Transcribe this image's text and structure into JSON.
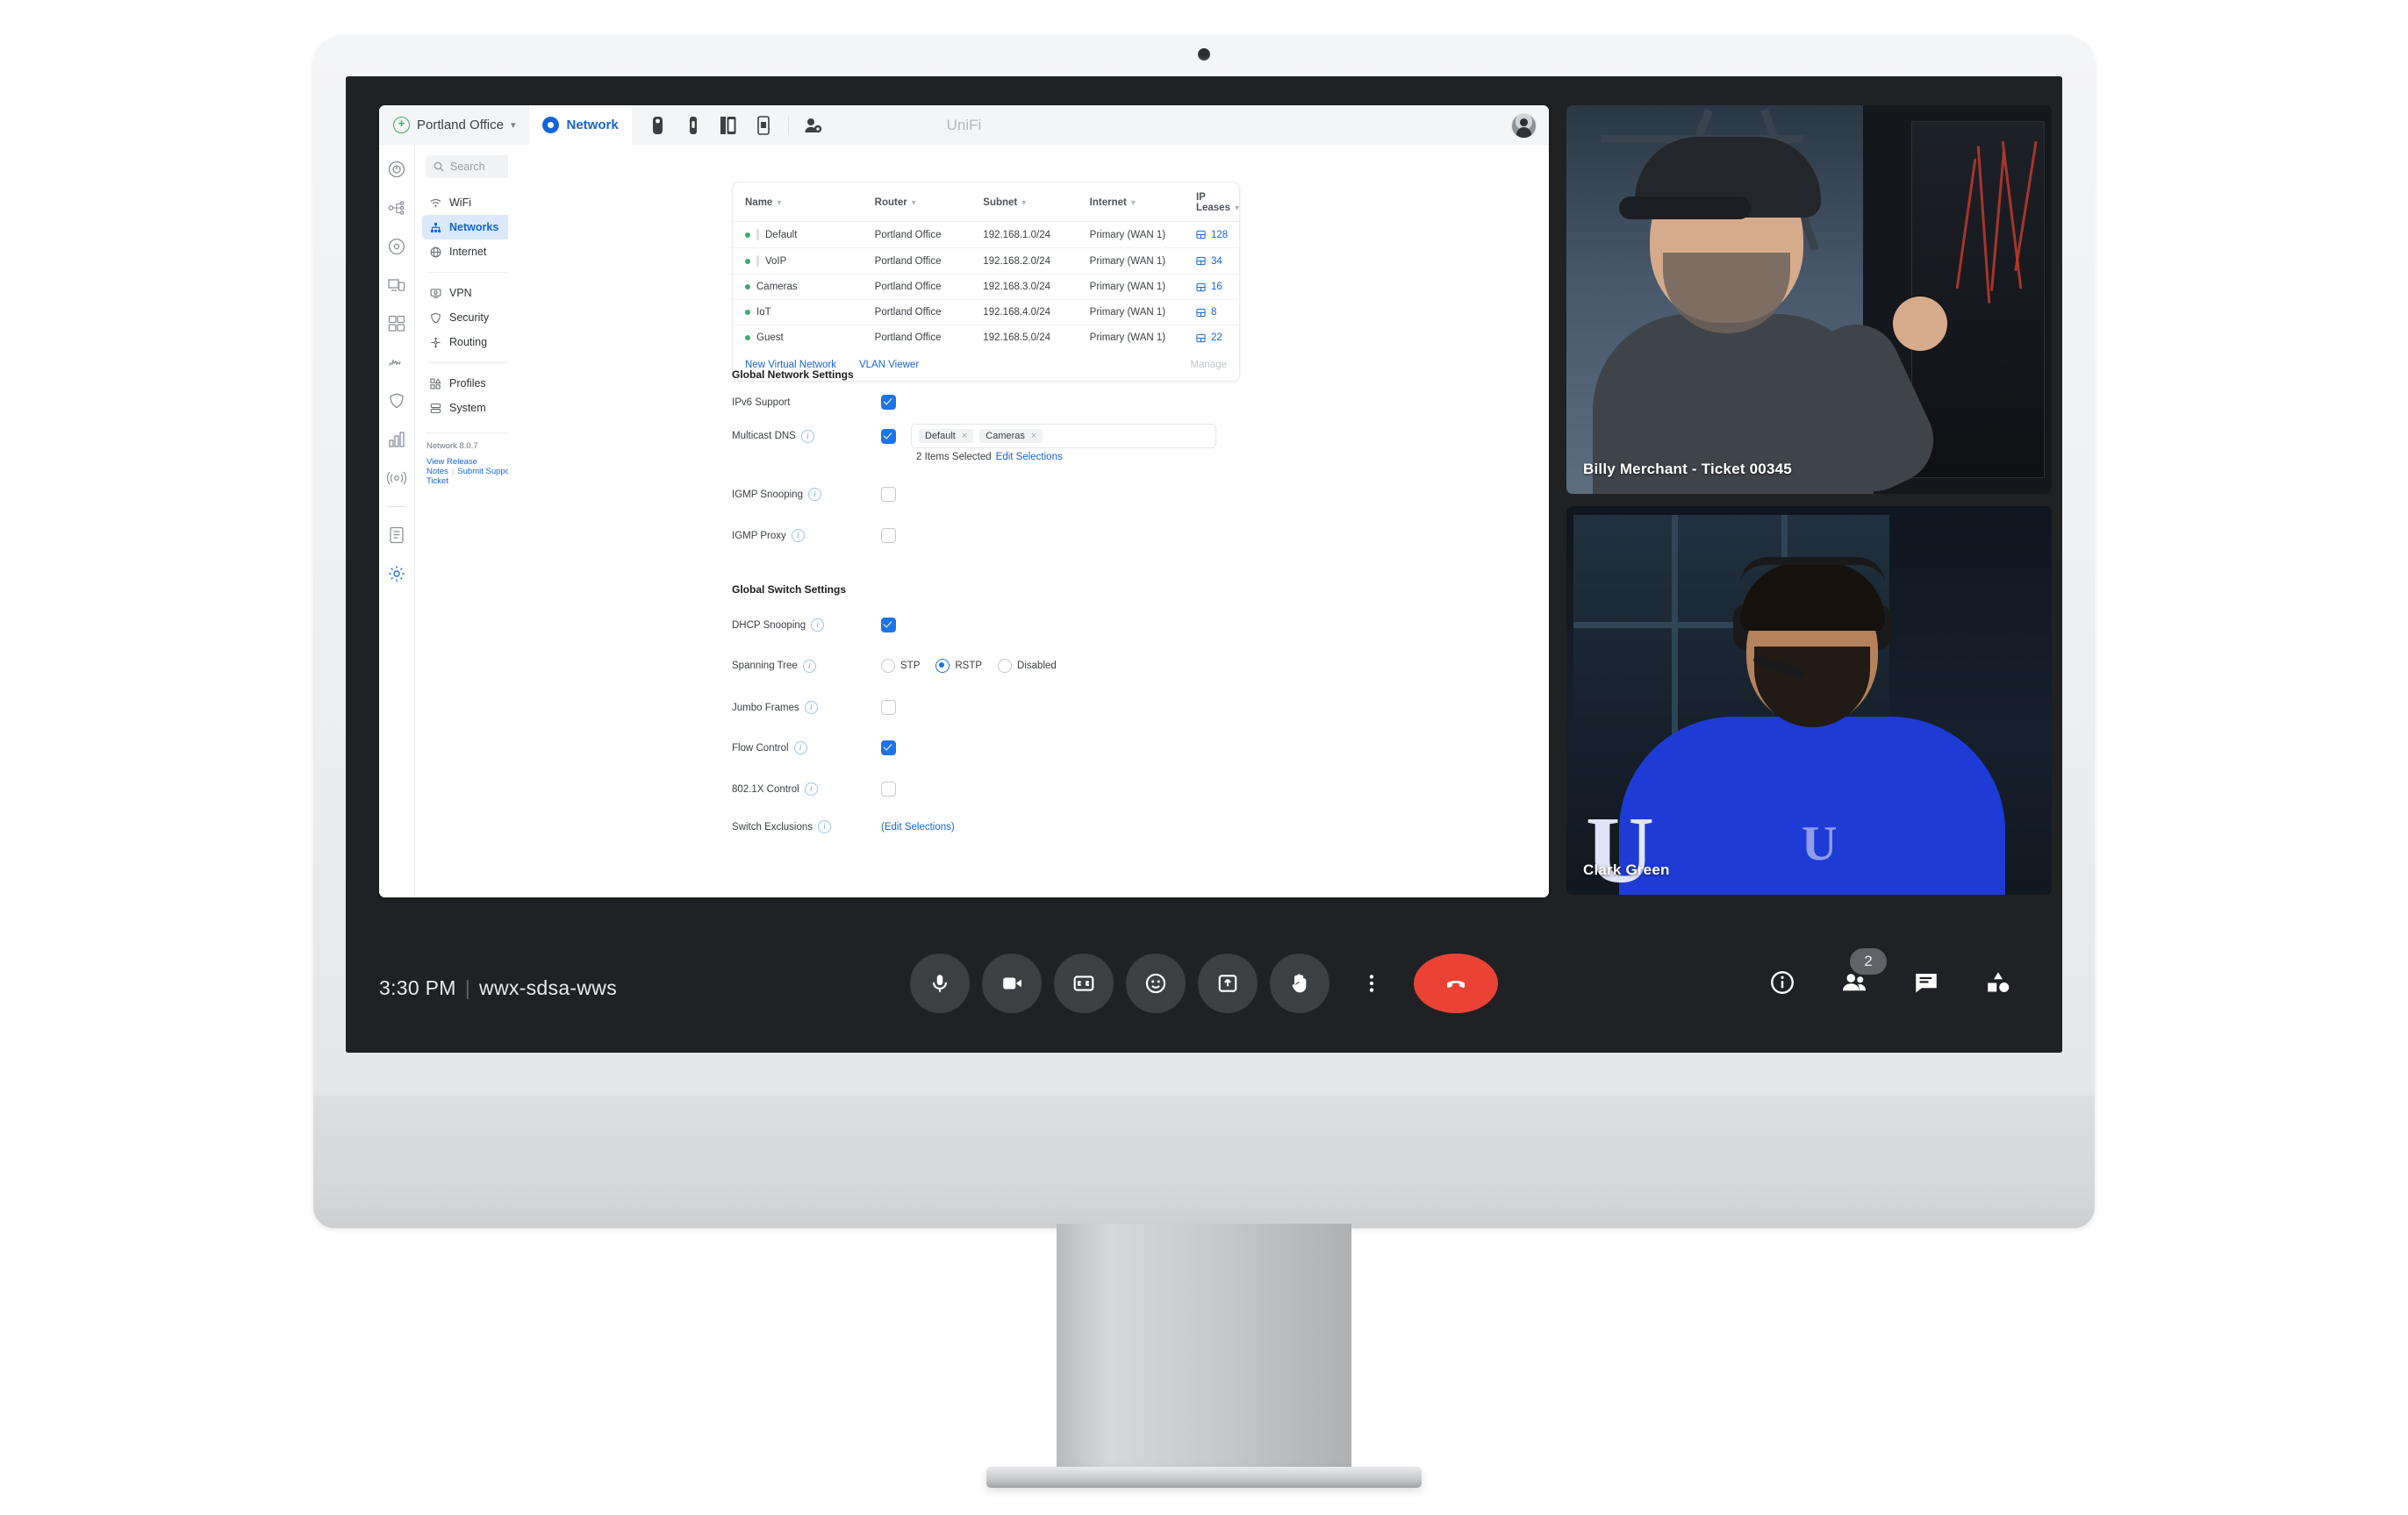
{
  "unifi": {
    "site_name": "Portland Office",
    "active_app": "Network",
    "window_title": "UniFi",
    "app_icons": [
      "protect-camera-icon",
      "talk-phone-icon",
      "access-door-icon",
      "connect-display-icon",
      "admin-user-icon"
    ],
    "search_placeholder": "Search",
    "nav": {
      "group1": [
        {
          "label": "WiFi",
          "icon": "wifi-icon",
          "active": false
        },
        {
          "label": "Networks",
          "icon": "network-topology-icon",
          "active": true
        },
        {
          "label": "Internet",
          "icon": "globe-icon",
          "active": false
        }
      ],
      "group2": [
        {
          "label": "VPN",
          "icon": "vpn-icon",
          "active": false
        },
        {
          "label": "Security",
          "icon": "shield-icon",
          "active": false
        },
        {
          "label": "Routing",
          "icon": "routing-icon",
          "active": false
        }
      ],
      "group3": [
        {
          "label": "Profiles",
          "icon": "profiles-icon",
          "active": false
        },
        {
          "label": "System",
          "icon": "system-icon",
          "active": false
        }
      ],
      "version": "Network 8.0.7",
      "release_notes_link": "View Release Notes",
      "support_link": "Submit Support Ticket"
    },
    "rail_icons": [
      "dashboard-icon",
      "topology-icon",
      "devices-icon",
      "client-devices-icon",
      "clients-icon",
      "insights-icon",
      "security-shield-icon",
      "statistics-icon",
      "wireless-icon",
      "logs-icon",
      "settings-gear-icon"
    ],
    "table": {
      "columns": [
        "Name",
        "Router",
        "Subnet",
        "Internet",
        "IP Leases"
      ],
      "rows": [
        {
          "name": "Default",
          "indent": true,
          "router": "Portland Office",
          "subnet": "192.168.1.0/24",
          "internet": "Primary (WAN 1)",
          "leases": "128"
        },
        {
          "name": "VoIP",
          "indent": true,
          "router": "Portland Office",
          "subnet": "192.168.2.0/24",
          "internet": "Primary (WAN 1)",
          "leases": "34"
        },
        {
          "name": "Cameras",
          "indent": false,
          "router": "Portland Office",
          "subnet": "192.168.3.0/24",
          "internet": "Primary (WAN 1)",
          "leases": "16"
        },
        {
          "name": "IoT",
          "indent": false,
          "router": "Portland Office",
          "subnet": "192.168.4.0/24",
          "internet": "Primary (WAN 1)",
          "leases": "8"
        },
        {
          "name": "Guest",
          "indent": false,
          "router": "Portland Office",
          "subnet": "192.168.5.0/24",
          "internet": "Primary (WAN 1)",
          "leases": "22"
        }
      ],
      "new_network_link": "New Virtual Network",
      "vlan_viewer_link": "VLAN Viewer",
      "manage_link": "Manage"
    },
    "network_settings": {
      "heading": "Global Network Settings",
      "ipv6": {
        "label": "IPv6 Support",
        "checked": true
      },
      "mdns": {
        "label": "Multicast DNS",
        "checked": true,
        "chips": [
          "Default",
          "Cameras"
        ],
        "selected_text": "2 Items Selected",
        "edit_link": "Edit Selections"
      },
      "igmp_snooping": {
        "label": "IGMP Snooping",
        "checked": false
      },
      "igmp_proxy": {
        "label": "IGMP Proxy",
        "checked": false
      }
    },
    "switch_settings": {
      "heading": "Global Switch Settings",
      "dhcp_snooping": {
        "label": "DHCP Snooping",
        "checked": true
      },
      "spanning_tree": {
        "label": "Spanning Tree",
        "options": [
          "STP",
          "RSTP",
          "Disabled"
        ],
        "selected": "RSTP"
      },
      "jumbo_frames": {
        "label": "Jumbo Frames",
        "checked": false
      },
      "flow_control": {
        "label": "Flow Control",
        "checked": true
      },
      "dot1x": {
        "label": "802.1X Control",
        "checked": false
      },
      "switch_exclusions": {
        "label": "Switch Exclusions",
        "link": "(Edit Selections)"
      }
    },
    "accent_blue": "#1b74e8",
    "link_blue": "#1565d8",
    "status_green": "#3ea96b"
  },
  "meet": {
    "time": "3:30 PM",
    "meeting_code": "wwx-sdsa-wws",
    "participants": [
      {
        "name": "Billy Merchant - Ticket 00345"
      },
      {
        "name": "Clark Green"
      }
    ],
    "controls": [
      {
        "name": "microphone-button",
        "icon": "mic"
      },
      {
        "name": "camera-button",
        "icon": "cam"
      },
      {
        "name": "captions-button",
        "icon": "cc"
      },
      {
        "name": "emoji-button",
        "icon": "emoji"
      },
      {
        "name": "present-screen-button",
        "icon": "present"
      },
      {
        "name": "raise-hand-button",
        "icon": "hand"
      },
      {
        "name": "more-options-button",
        "icon": "more"
      },
      {
        "name": "end-call-button",
        "icon": "endcall"
      }
    ],
    "right_controls": [
      {
        "name": "meeting-details-button",
        "icon": "info"
      },
      {
        "name": "people-button",
        "icon": "people",
        "badge": "2"
      },
      {
        "name": "chat-button",
        "icon": "chat"
      },
      {
        "name": "activities-button",
        "icon": "activities"
      }
    ]
  }
}
